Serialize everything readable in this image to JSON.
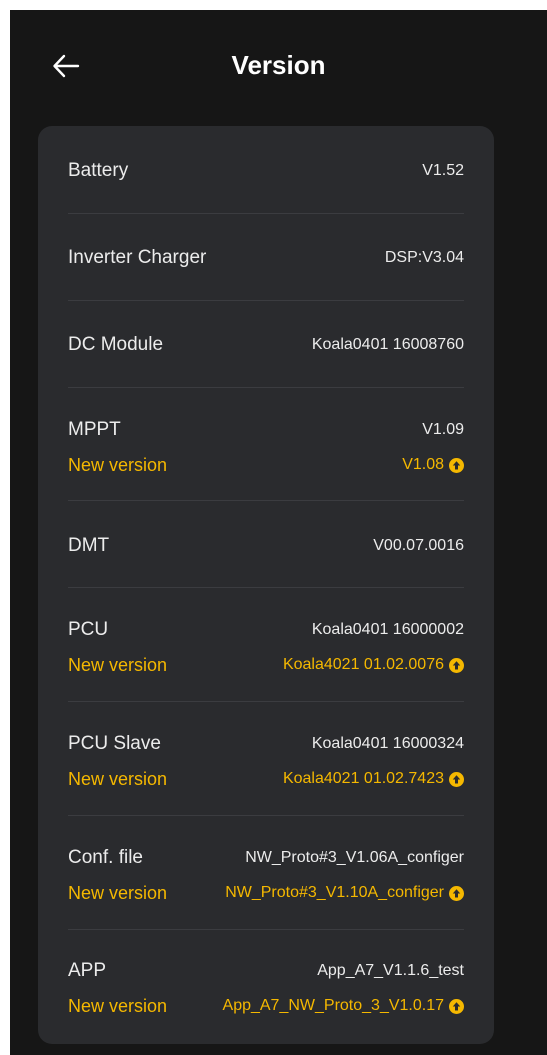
{
  "header": {
    "title": "Version"
  },
  "colors": {
    "background": "#161616",
    "card": "#2a2b2e",
    "accent": "#f5b800",
    "text": "#ececec"
  },
  "items": [
    {
      "label": "Battery",
      "value": "V1.52"
    },
    {
      "label": "Inverter Charger",
      "value": "DSP:V3.04"
    },
    {
      "label": "DC Module",
      "value": "Koala0401 16008760"
    },
    {
      "label": "MPPT",
      "value": "V1.09",
      "new_label": "New version",
      "new_value": "V1.08"
    },
    {
      "label": "DMT",
      "value": "V00.07.0016"
    },
    {
      "label": "PCU",
      "value": "Koala0401 16000002",
      "new_label": "New version",
      "new_value": "Koala4021 01.02.0076"
    },
    {
      "label": "PCU Slave",
      "value": "Koala0401 16000324",
      "new_label": "New version",
      "new_value": "Koala4021 01.02.7423"
    },
    {
      "label": "Conf. file",
      "value": "NW_Proto#3_V1.06A_configer",
      "new_label": "New version",
      "new_value": "NW_Proto#3_V1.10A_configer"
    },
    {
      "label": "APP",
      "value": "App_A7_V1.1.6_test",
      "new_label": "New version",
      "new_value": "App_A7_NW_Proto_3_V1.0.17"
    }
  ]
}
